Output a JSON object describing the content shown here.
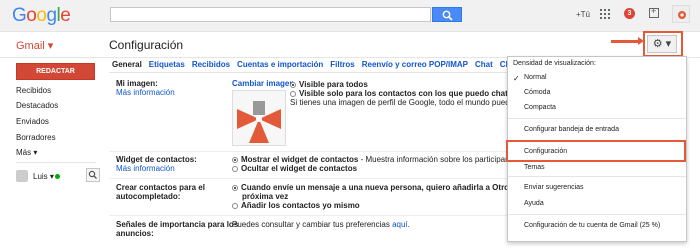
{
  "header": {
    "logo": [
      "G",
      "o",
      "o",
      "g",
      "l",
      "e"
    ],
    "logo_colors": [
      "#4285f4",
      "#ea4335",
      "#fbbc05",
      "#4285f4",
      "#34a853",
      "#ea4335"
    ],
    "search_placeholder": "",
    "plus_label": "+Tú",
    "notifications": "3"
  },
  "subbar": {
    "app_label": "Gmail ▾",
    "page_title": "Configuración",
    "gear_label": "⚙ ▾"
  },
  "sidebar": {
    "compose": "REDACTAR",
    "items": [
      "Recibidos",
      "Destacados",
      "Enviados",
      "Borradores",
      "Más ▾"
    ],
    "chat_user": "Luis ▾"
  },
  "tabs": [
    "General",
    "Etiquetas",
    "Recibidos",
    "Cuentas e importación",
    "Filtros",
    "Reenvío y correo POP/IMAP",
    "Chat",
    "Clips de la"
  ],
  "settings": {
    "image": {
      "label": "Mi imagen:",
      "more": "Más información",
      "change": "Cambiar imagen",
      "opt1": "Visible para todos",
      "opt2": "Visible solo para los contactos con los que puedo chatear",
      "note": "Si tienes una imagen de perfil de Google, todo el mundo puede verla."
    },
    "contacts_widget": {
      "label": "Widget de contactos:",
      "more": "Más información",
      "opt1_bold": "Mostrar el widget de contactos",
      "opt1_rest": " - Muestra información sobre los participantes en la conve",
      "opt2": "Ocultar el widget de contactos"
    },
    "autocomplete": {
      "label1": "Crear contactos para el",
      "label2": "autocompletado:",
      "opt1a": "Cuando envíe un mensaje a una nueva persona, quiero añadirla a Otros contactos pa",
      "opt1b": "próxima vez",
      "opt2": "Añadir los contactos yo mismo"
    },
    "importance": {
      "label1": "Señales de importancia para los",
      "label2": "anuncios:",
      "text": "Puedes consultar y cambiar tus preferencias ",
      "link": "aquí",
      "end": "."
    }
  },
  "menu": {
    "heading": "Densidad de visualización:",
    "density": [
      "Normal",
      "Cómoda",
      "Compacta"
    ],
    "check": "✓",
    "items": [
      "Configurar bandeja de entrada",
      "Configuración",
      "Temas",
      "Enviar sugerencias",
      "Ayuda",
      "Configuración de tu cuenta de Gmail (25 %)"
    ]
  },
  "colors": {
    "accent_red": "#d14836",
    "annotation": "#e35a3a",
    "link": "#1155cc",
    "search_blue": "#4a8af4"
  }
}
